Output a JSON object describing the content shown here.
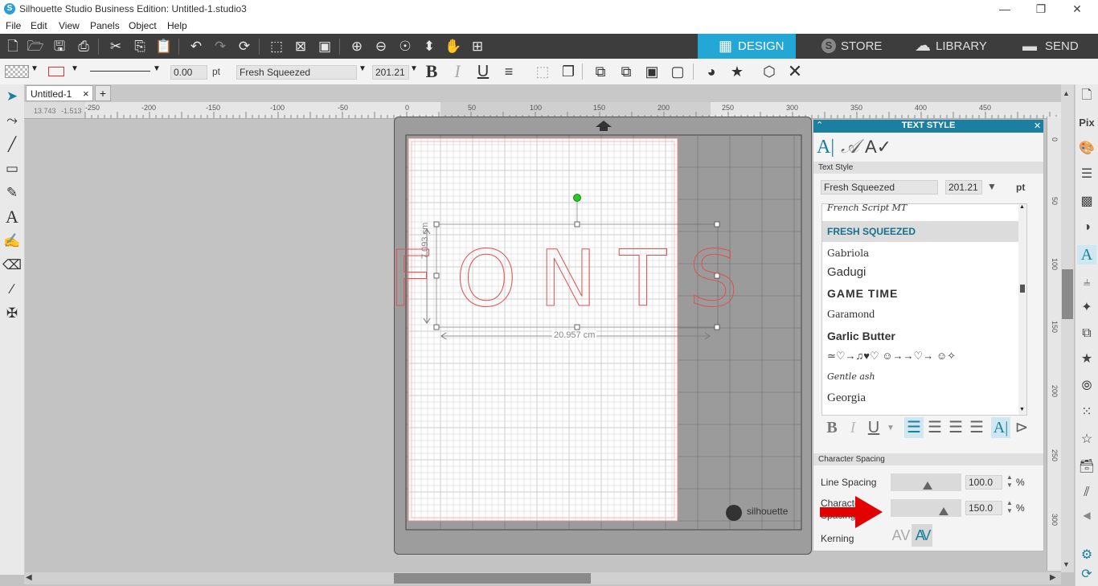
{
  "window": {
    "title": "Silhouette Studio Business Edition: Untitled-1.studio3",
    "minimize": "—",
    "restore": "❐",
    "close": "✕"
  },
  "menu": [
    "File",
    "Edit",
    "View",
    "Panels",
    "Object",
    "Help"
  ],
  "main_tabs": [
    {
      "label": "DESIGN",
      "icon": "grid-icon",
      "glyph": "▦"
    },
    {
      "label": "STORE",
      "icon": "silhouette-s-icon",
      "glyph": "S"
    },
    {
      "label": "LIBRARY",
      "icon": "cloud-icon",
      "glyph": "☁"
    },
    {
      "label": "SEND",
      "icon": "cutter-icon",
      "glyph": "▬"
    }
  ],
  "line_toolbar": {
    "line_width_value": "0.00",
    "line_width_unit": "pt",
    "font_name": "Fresh Squeezed",
    "font_size": "201.21",
    "bold": "B",
    "italic": "I",
    "underline": "U"
  },
  "document_tab": {
    "label": "Untitled-1",
    "close": "×",
    "add": "+"
  },
  "ruler": {
    "corner_x": "13.743",
    "corner_y": "-1.513",
    "h_labels": [
      "-250",
      "-200",
      "-150",
      "-100",
      "-50",
      "0",
      "50",
      "100",
      "150",
      "200",
      "250",
      "300",
      "350",
      "400",
      "450"
    ],
    "v_labels": [
      "0",
      "50",
      "100",
      "150",
      "200",
      "250",
      "300"
    ]
  },
  "canvas": {
    "text": "FONTS",
    "height_dim": "7.093 cm",
    "width_dim": "20.957 cm",
    "brand": "silhouette"
  },
  "text_style_panel": {
    "title": "TEXT STYLE",
    "section_text_style": "Text Style",
    "font_field": "Fresh Squeezed",
    "size_field": "201.21",
    "size_unit": "pt",
    "fonts": [
      {
        "name": "French Script MT",
        "selected": false
      },
      {
        "name": "FRESH SQUEEZED",
        "selected": true
      },
      {
        "name": "Gabriola",
        "selected": false
      },
      {
        "name": "Gadugi",
        "selected": false
      },
      {
        "name": "GAME TIME",
        "selected": false
      },
      {
        "name": "Garamond",
        "selected": false
      },
      {
        "name": "Garlic Butter",
        "selected": false
      },
      {
        "name": "≃♡→♫♥♡ ☺→→♡→ ☺✧",
        "selected": false
      },
      {
        "name": "Gentle ash",
        "selected": false
      },
      {
        "name": "Georgia",
        "selected": false
      }
    ],
    "format_bold": "B",
    "format_italic": "I",
    "format_underline": "U",
    "section_character_spacing": "Character Spacing",
    "line_spacing_label": "Line Spacing",
    "line_spacing_value": "100.0",
    "line_spacing_unit": "%",
    "char_spacing_label_1": "Character",
    "char_spacing_label_2": "Spacing",
    "char_spacing_value": "150.0",
    "char_spacing_unit": "%",
    "kerning_label": "Kerning",
    "kerning_off": "AV",
    "kerning_on": "AV"
  },
  "colors": {
    "accent": "#23a7d4",
    "panel_header": "#1a7fa0",
    "text_outline": "#e05050",
    "arrow": "#e30000"
  }
}
